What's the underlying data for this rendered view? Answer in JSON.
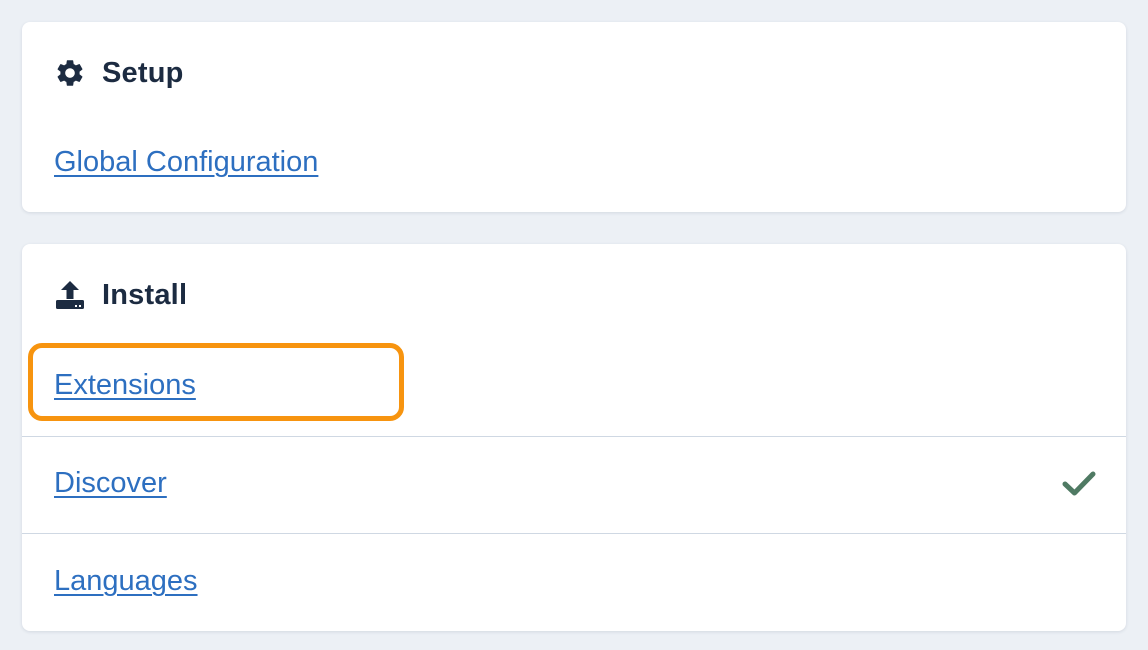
{
  "setup": {
    "title": "Setup",
    "icon": "gear-icon",
    "links": [
      {
        "label": "Global Configuration"
      }
    ]
  },
  "install": {
    "title": "Install",
    "icon": "upload-icon",
    "links": [
      {
        "label": "Extensions",
        "highlighted": true
      },
      {
        "label": "Discover",
        "status_icon": "checkmark-icon"
      },
      {
        "label": "Languages"
      }
    ]
  },
  "colors": {
    "background": "#ecf0f5",
    "title": "#1c2b41",
    "link": "#2d6fc0",
    "highlight": "#f7940f",
    "checkmark": "#4f7a63"
  }
}
